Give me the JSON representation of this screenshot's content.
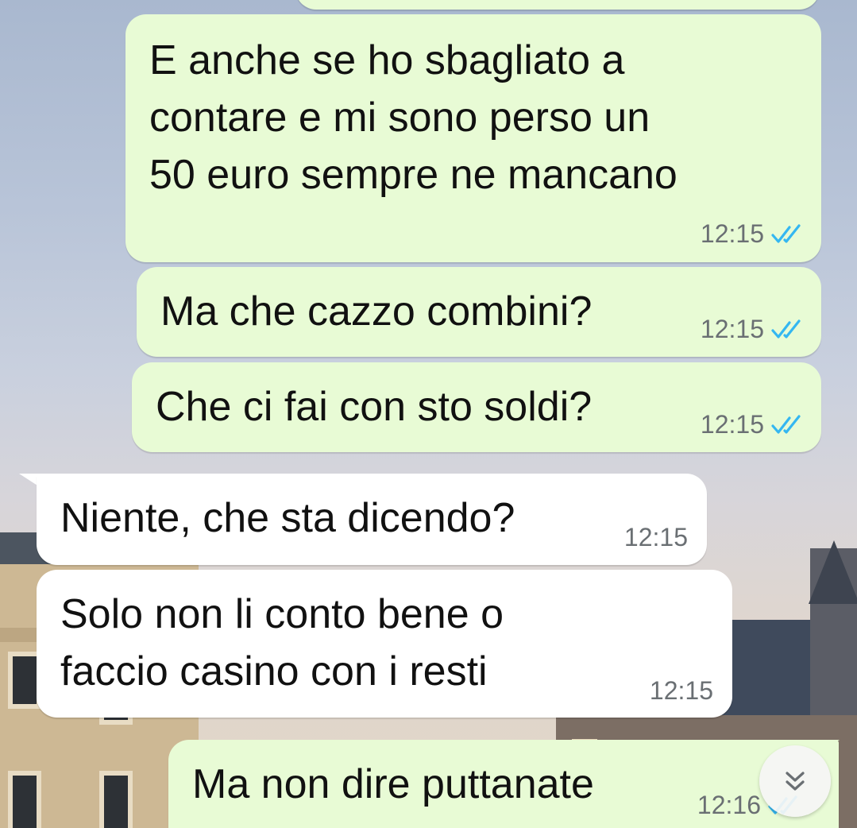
{
  "colors": {
    "outgoing_bubble": "#e8fbd5",
    "incoming_bubble": "#ffffff",
    "read_ticks": "#34b7f1",
    "timestamp": "#6a6f73"
  },
  "messages": [
    {
      "direction": "outgoing",
      "text": "E anche se ho sbagliato a\ncontare e mi sono perso un\n50 euro sempre ne mancano",
      "time": "12:15",
      "status": "read"
    },
    {
      "direction": "outgoing",
      "text": "Ma che cazzo combini?",
      "time": "12:15",
      "status": "read"
    },
    {
      "direction": "outgoing",
      "text": "Che ci fai con sto soldi?",
      "time": "12:15",
      "status": "read"
    },
    {
      "direction": "incoming",
      "text": "Niente, che sta dicendo?",
      "time": "12:15"
    },
    {
      "direction": "incoming",
      "text": "Solo non li conto bene o\nfaccio casino con i resti",
      "time": "12:15"
    },
    {
      "direction": "outgoing",
      "text": "Ma non dire puttanate",
      "time": "12:16",
      "status": "read"
    }
  ],
  "scroll_button": {
    "icon": "double-chevron-down-icon"
  }
}
